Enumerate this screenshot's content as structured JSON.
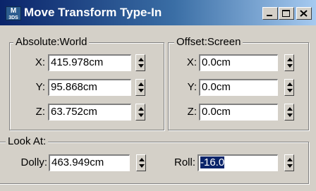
{
  "window": {
    "title": "Move Transform Type-In",
    "icon_label": "3DS",
    "icon_letter": "M",
    "controls": {
      "minimize": "minimize-icon",
      "maximize": "maximize-icon",
      "close": "close-icon"
    }
  },
  "absolute": {
    "label": "Absolute:World",
    "x_label": "X:",
    "x_value": "415.978cm",
    "y_label": "Y:",
    "y_value": "95.868cm",
    "z_label": "Z:",
    "z_value": "63.752cm"
  },
  "offset": {
    "label": "Offset:Screen",
    "x_label": "X:",
    "x_value": "0.0cm",
    "y_label": "Y:",
    "y_value": "0.0cm",
    "z_label": "Z:",
    "z_value": "0.0cm"
  },
  "lookat": {
    "label": "Look At:",
    "dolly_label": "Dolly:",
    "dolly_value": "463.949cm",
    "roll_label": "Roll:",
    "roll_value": "-16.0"
  },
  "colors": {
    "titlebar_start": "#0a246a",
    "titlebar_end": "#a6caf0",
    "dialog_face": "#d4d0c8",
    "selection": "#0a246a"
  }
}
